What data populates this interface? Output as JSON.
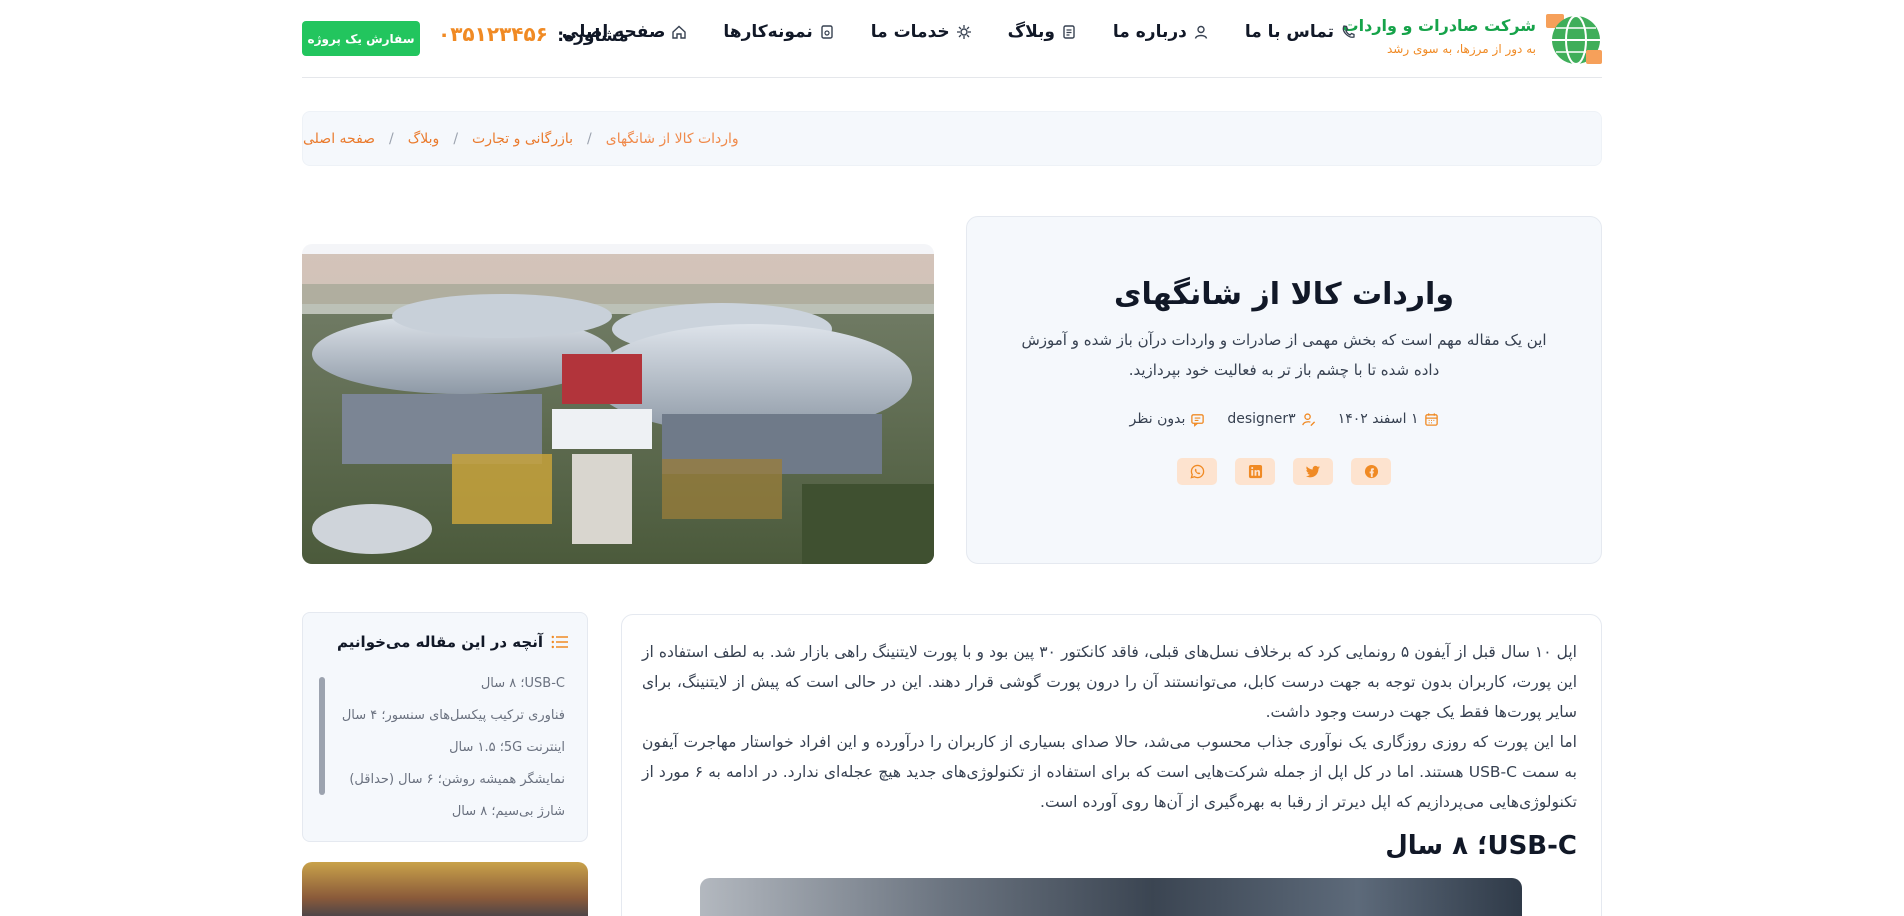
{
  "brand": {
    "title": "شرکت صادرات و واردات",
    "tagline": "به دور از مرزها، به سوی رشد"
  },
  "nav": {
    "items": [
      {
        "label": "صفحه اصلی",
        "icon": "home-icon"
      },
      {
        "label": "نمونه‌کارها",
        "icon": "portfolio-icon"
      },
      {
        "label": "خدمات ما",
        "icon": "services-icon"
      },
      {
        "label": "وبلاگ",
        "icon": "blog-icon"
      },
      {
        "label": "درباره ما",
        "icon": "about-icon"
      },
      {
        "label": "تماس با ما",
        "icon": "phone-icon"
      }
    ]
  },
  "consult": {
    "label": "مشاوره:",
    "phone": "۰۳۵۱۲۳۴۵۶"
  },
  "order_button": "سفارش یک پروژه",
  "breadcrumb": {
    "items": [
      "صفحه اصلی",
      "وبلاگ",
      "بازرگانی و تجارت"
    ],
    "current": "واردات کالا از شانگهای",
    "separator": "/"
  },
  "post": {
    "title": "واردات کالا از شانگهای",
    "description": "این یک مقاله مهم است که بخش مهمی از صادرات و واردات درآن باز شده و آموزش داده شده تا با چشم باز تر به فعالیت خود بپردازید.",
    "date": "۱ اسفند ۱۴۰۲",
    "author": "designer۳",
    "comments": "بدون نظر",
    "share": [
      "facebook-icon",
      "twitter-icon",
      "linkedin-icon",
      "whatsapp-icon"
    ]
  },
  "toc": {
    "heading": "آنچه در این مقاله می‌خوانیم",
    "items": [
      "USB-C؛ ۸ سال",
      "فناوری ترکیب پیکسل‌های سنسور؛ ۴ سال",
      "اینترنت 5G؛ ۱.۵ سال",
      "نمایشگر همیشه روشن؛ ۶ سال (حداقل)",
      "شارژ بی‌سیم؛ ۸ سال"
    ]
  },
  "article": {
    "paragraph1": "اپل ۱۰ سال قبل از آیفون ۵ رونمایی کرد که برخلاف نسل‌های قبلی، فاقد کانکتور ۳۰ پین بود و با پورت لایتنینگ راهی بازار شد. به لطف استفاده از این پورت، کاربران بدون توجه به جهت درست کابل، می‌توانستند آن را درون پورت گوشی قرار دهند. این در حالی است که پیش از لایتنینگ، برای سایر پورت‌ها فقط یک جهت درست وجود داشت.",
    "paragraph2": "اما این پورت که روزی روزگاری یک نوآوری جذاب محسوب می‌شد، حالا صدای بسیاری از کاربران را درآورده و این افراد خواستار مهاجرت آیفون به سمت USB-C هستند. اما در کل اپل از جمله شرکت‌هایی است که برای استفاده از تکنولوژی‌های جدید هیچ عجله‌ای ندارد. در ادامه به ۶ مورد از تکنولوژی‌هایی می‌پردازیم که اپل دیرتر از رقبا به بهره‌گیری از آن‌ها روی آورده است.",
    "heading": "USB-C؛ ۸ سال"
  },
  "colors": {
    "accent": "#f08a24",
    "green": "#22c55e",
    "brand_green": "#16a34a"
  }
}
